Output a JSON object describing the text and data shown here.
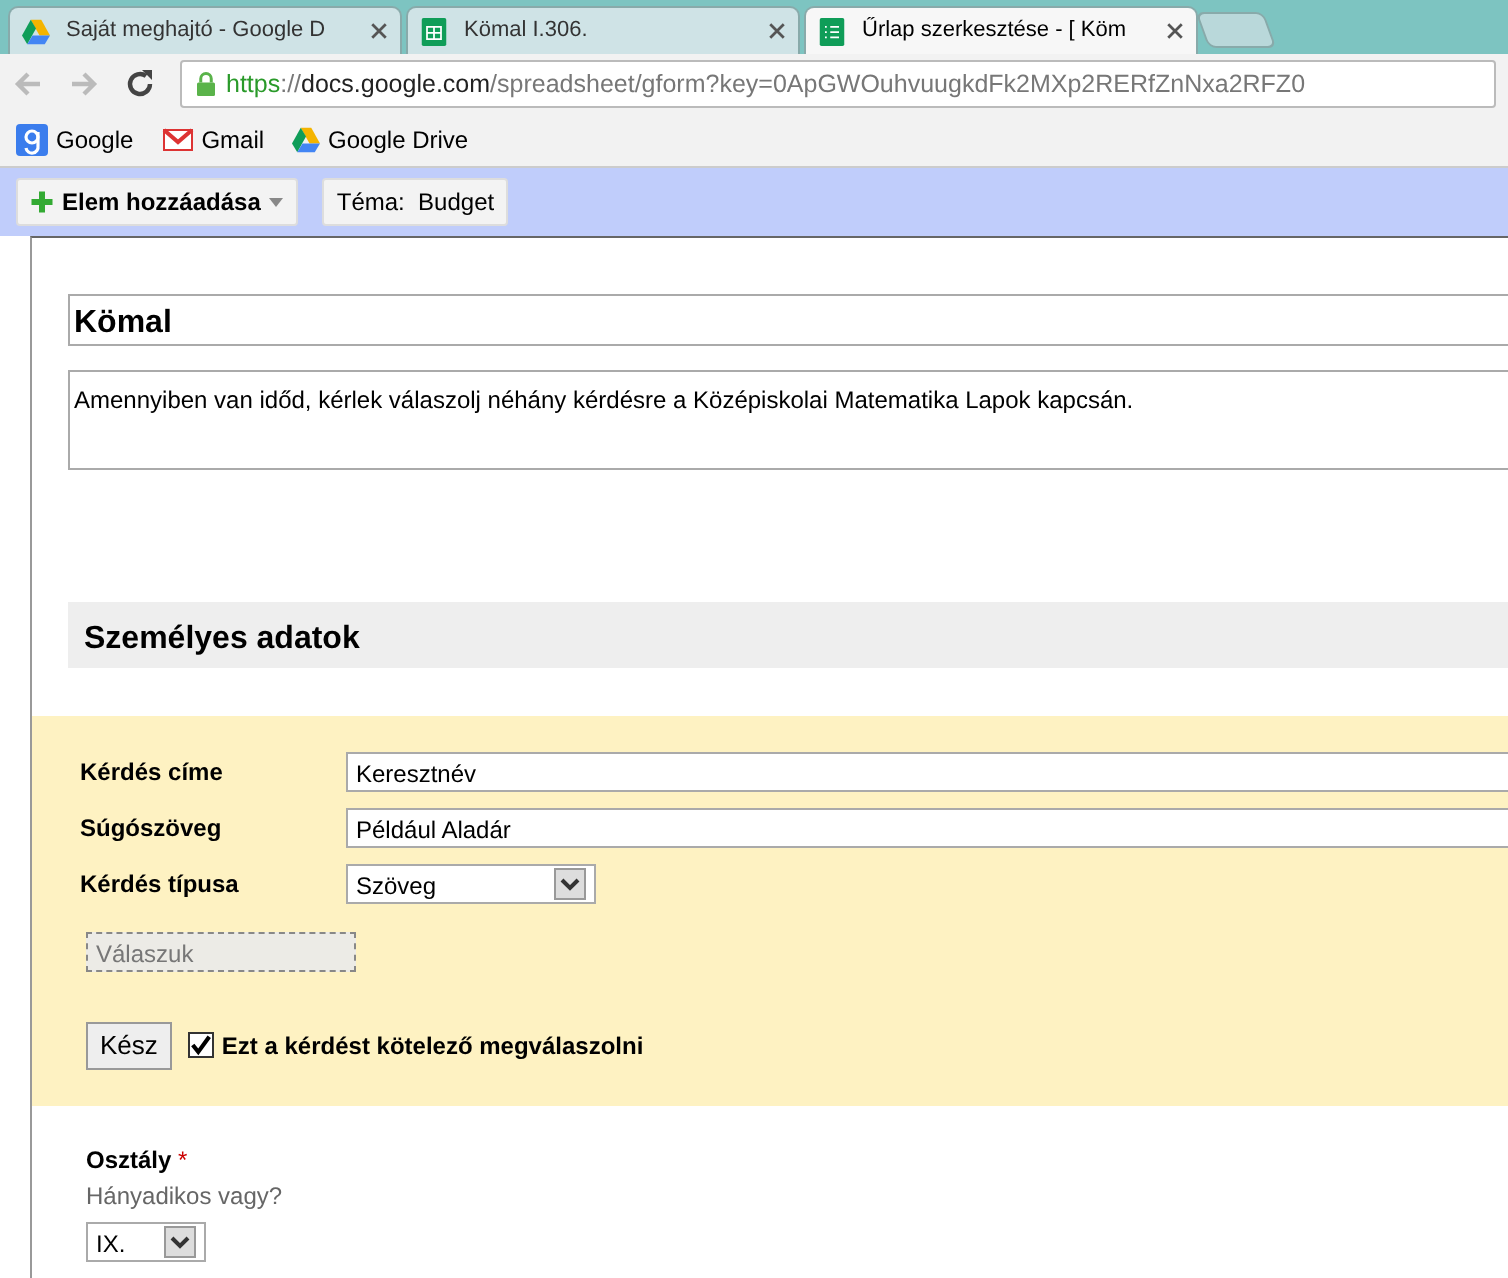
{
  "browser": {
    "tabs": [
      {
        "title": "Saját meghajtó - Google D",
        "selected": false
      },
      {
        "title": "Kömal I.306.",
        "selected": false
      },
      {
        "title": "Űrlap szerkesztése - [ Köm",
        "selected": true
      }
    ],
    "url": {
      "scheme": "https",
      "separator": "://",
      "host": "docs.google.com",
      "path": "/spreadsheet/gform?key=0ApGWOuhvuugkdFk2MXp2RERfZnNxa2RFZ0"
    },
    "bookmarks": [
      {
        "label": "Google"
      },
      {
        "label": "Gmail"
      },
      {
        "label": "Google Drive"
      }
    ]
  },
  "toolbar": {
    "add_item": "Elem hozzáadása",
    "theme_label": "Téma:",
    "theme": "Budget"
  },
  "form": {
    "title": "Kömal",
    "description": "Amennyiben van időd, kérlek válaszolj néhány kérdésre a Középiskolai Matematika Lapok kapcsán.",
    "section": "Személyes adatok",
    "editor": {
      "title_label": "Kérdés címe",
      "title_value": "Keresztnév",
      "help_label": "Súgószöveg",
      "help_value": "Például Aladár",
      "type_label": "Kérdés típusa",
      "type_value": "Szöveg",
      "answer_placeholder": "Válaszuk",
      "done": "Kész",
      "required_label": "Ezt a kérdést kötelező megválaszolni",
      "required": true
    },
    "question": {
      "title": "Osztály",
      "required_mark": "*",
      "help": "Hányadikos vagy?",
      "value": "IX."
    }
  }
}
